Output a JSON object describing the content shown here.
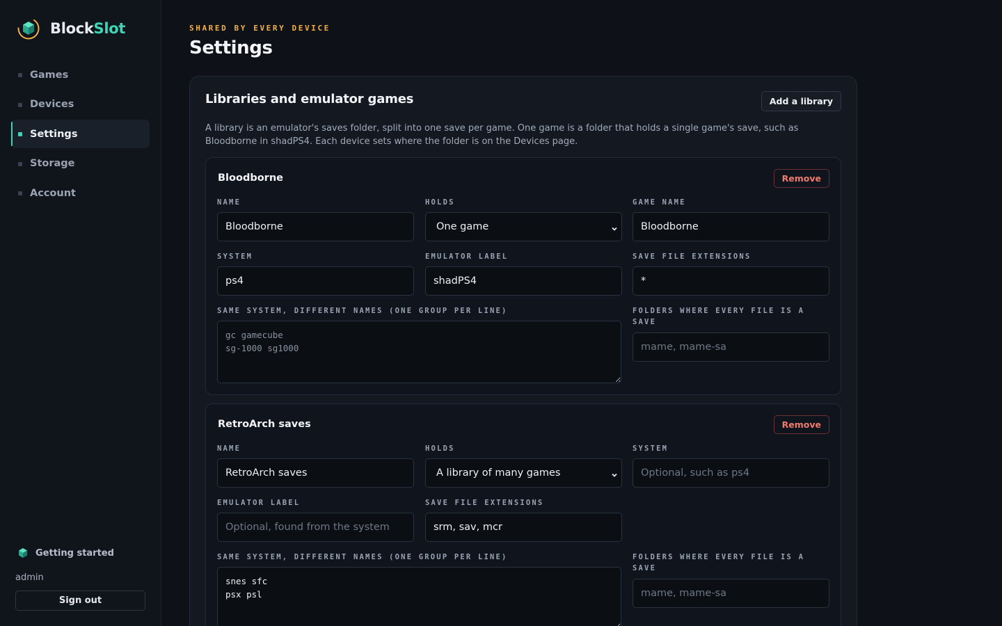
{
  "brand": {
    "name_part1": "Block",
    "name_part2": "Slot"
  },
  "sidebar": {
    "items": [
      {
        "label": "Games",
        "active": false
      },
      {
        "label": "Devices",
        "active": false
      },
      {
        "label": "Settings",
        "active": true
      },
      {
        "label": "Storage",
        "active": false
      },
      {
        "label": "Account",
        "active": false
      }
    ],
    "getting_started": "Getting started",
    "user": "admin",
    "sign_out": "Sign out"
  },
  "header": {
    "eyebrow": "SHARED BY EVERY DEVICE",
    "title": "Settings"
  },
  "card": {
    "title": "Libraries and emulator games",
    "add_button": "Add a library",
    "description": "A library is an emulator's saves folder, split into one save per game. One game is a folder that holds a single game's save, such as Bloodborne in shadPS4. Each device sets where the folder is on the Devices page."
  },
  "libraries": [
    {
      "title": "Bloodborne",
      "remove": "Remove",
      "fields": {
        "name": {
          "label": "NAME",
          "value": "Bloodborne"
        },
        "holds": {
          "label": "HOLDS",
          "value": "One game"
        },
        "game_name": {
          "label": "GAME NAME",
          "value": "Bloodborne"
        },
        "system": {
          "label": "SYSTEM",
          "value": "ps4"
        },
        "emulator_label": {
          "label": "EMULATOR LABEL",
          "value": "shadPS4"
        },
        "save_ext": {
          "label": "SAVE FILE EXTENSIONS",
          "value": "*"
        },
        "aliases": {
          "label": "SAME SYSTEM, DIFFERENT NAMES (ONE GROUP PER LINE)",
          "value": "",
          "placeholder": "gc gamecube\nsg-1000 sg1000"
        },
        "folders": {
          "label": "FOLDERS WHERE EVERY FILE IS A SAVE",
          "value": "",
          "placeholder": "mame, mame-sa"
        }
      }
    },
    {
      "title": "RetroArch saves",
      "remove": "Remove",
      "fields": {
        "name": {
          "label": "NAME",
          "value": "RetroArch saves"
        },
        "holds": {
          "label": "HOLDS",
          "value": "A library of many games"
        },
        "system": {
          "label": "SYSTEM",
          "value": "",
          "placeholder": "Optional, such as ps4"
        },
        "emulator_label": {
          "label": "EMULATOR LABEL",
          "value": "",
          "placeholder": "Optional, found from the system"
        },
        "save_ext": {
          "label": "SAVE FILE EXTENSIONS",
          "value": "srm, sav, mcr"
        },
        "aliases": {
          "label": "SAME SYSTEM, DIFFERENT NAMES (ONE GROUP PER LINE)",
          "value": "snes sfc\npsx psl"
        },
        "folders": {
          "label": "FOLDERS WHERE EVERY FILE IS A SAVE",
          "value": "",
          "placeholder": "mame, mame-sa"
        }
      }
    }
  ],
  "colors": {
    "accent": "#3fd4b6",
    "eyebrow": "#f0b04a",
    "danger": "#f07a6e",
    "background": "#0e1117"
  }
}
